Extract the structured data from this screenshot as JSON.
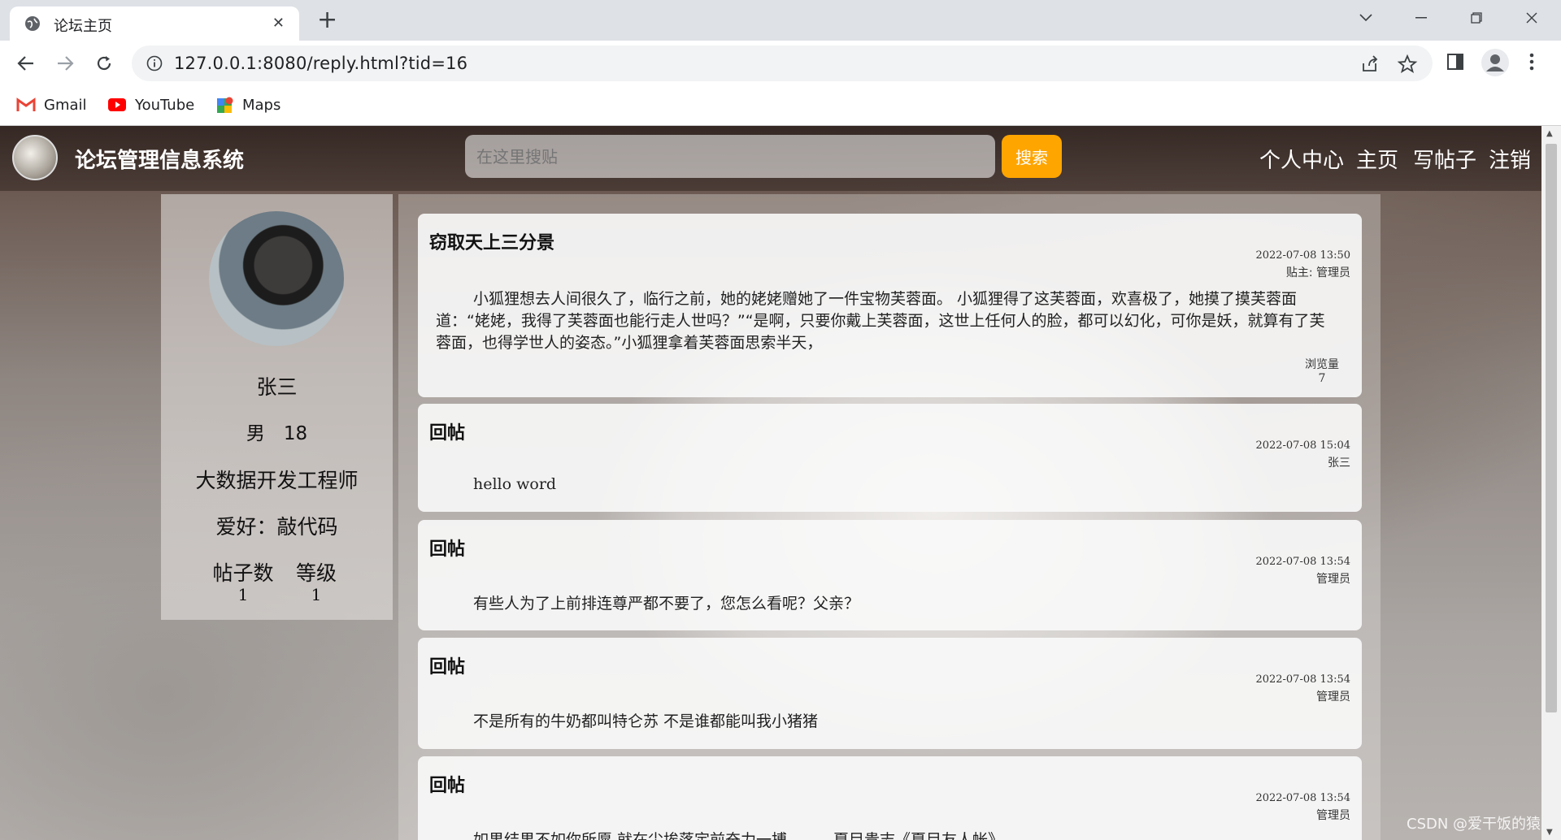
{
  "browser": {
    "tab_title": "论坛主页",
    "url": "127.0.0.1:8080/reply.html?tid=16",
    "bookmarks": [
      {
        "label": "Gmail",
        "icon": "gmail-icon"
      },
      {
        "label": "YouTube",
        "icon": "youtube-icon"
      },
      {
        "label": "Maps",
        "icon": "maps-icon"
      }
    ]
  },
  "header": {
    "site_title": "论坛管理信息系统",
    "search_placeholder": "在这里搜贴",
    "search_button": "搜索",
    "nav": [
      "个人中心",
      "主页",
      "写帖子",
      "注销"
    ]
  },
  "profile": {
    "name": "张三",
    "sex_age": "男　18",
    "job": "大数据开发工程师",
    "hobby": "爱好：敲代码",
    "stats": [
      {
        "label": "帖子数",
        "value": "1"
      },
      {
        "label": "等级",
        "value": "1"
      }
    ]
  },
  "post": {
    "title": "窃取天上三分景",
    "time": "2022-07-08 13:50",
    "author": "贴主: 管理员",
    "content": "小狐狸想去人间很久了，临行之前，她的姥姥赠她了一件宝物芙蓉面。 小狐狸得了这芙蓉面，欢喜极了，她摸了摸芙蓉面道：“姥姥，我得了芙蓉面也能行走人世吗？”“是啊，只要你戴上芙蓉面，这世上任何人的脸，都可以幻化，可你是妖，就算有了芙蓉面，也得学世人的姿态。”小狐狸拿着芙蓉面思索半天，",
    "views_label": "浏览量",
    "views": "7"
  },
  "replies": [
    {
      "title": "回帖",
      "time": "2022-07-08 15:04",
      "author": "张三",
      "content": "hello word"
    },
    {
      "title": "回帖",
      "time": "2022-07-08 13:54",
      "author": "管理员",
      "content": "有些人为了上前排连尊严都不要了，您怎么看呢？父亲？"
    },
    {
      "title": "回帖",
      "time": "2022-07-08 13:54",
      "author": "管理员",
      "content": "不是所有的牛奶都叫特仑苏 不是谁都能叫我小猪猪"
    },
    {
      "title": "回帖",
      "time": "2022-07-08 13:54",
      "author": "管理员",
      "content": "如果结果不如你所愿,就在尘埃落定前奋力一搏。——夏目贵志《夏目友人帐》"
    }
  ],
  "watermark": "CSDN @爱干饭的猿",
  "colors": {
    "accent": "#ffa500",
    "header_bg": "#3a2c27"
  }
}
